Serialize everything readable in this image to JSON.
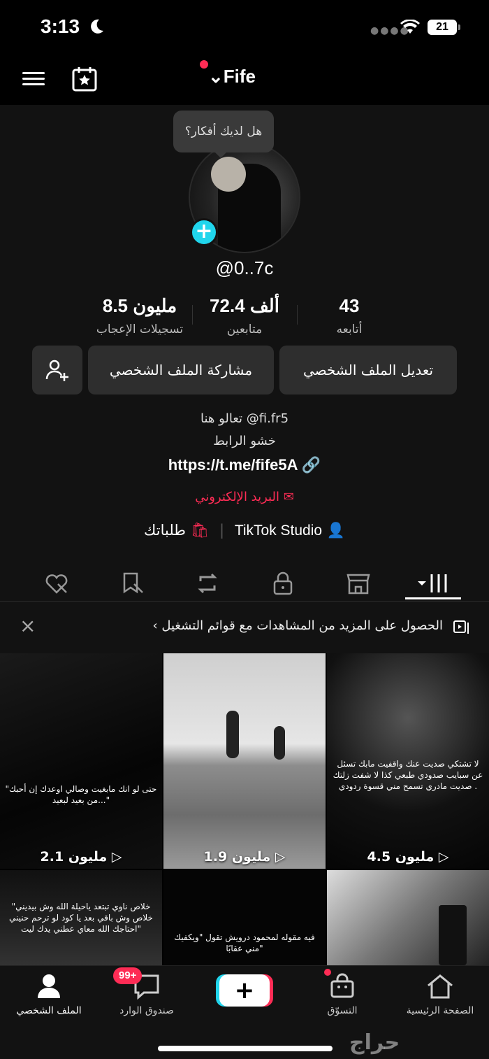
{
  "status_bar": {
    "time": "3:13",
    "battery": "21"
  },
  "top_nav": {
    "account_name": "Fife"
  },
  "profile": {
    "tooltip": "هل لديك أفكار؟",
    "username": "@0..7c",
    "stats": [
      {
        "value": "43",
        "label": "أتابعه"
      },
      {
        "value": "72.4 ألف",
        "label": "متابعين"
      },
      {
        "value": "8.5 مليون",
        "label": "تسجيلات الإعجاب"
      }
    ],
    "buttons": {
      "edit": "تعديل الملف الشخصي",
      "share": "مشاركة الملف الشخصي"
    },
    "bio_line1": "تعالو هنا @fi.fr5",
    "bio_line2": "خشو الرابط",
    "link": "https://t.me/fife5A",
    "email": "البريد الإلكتروني",
    "studio": "TikTok Studio",
    "orders": "طلباتك"
  },
  "banner": {
    "text": "الحصول على المزيد من المشاهدات مع قوائم التشغيل",
    "close": "×"
  },
  "videos": [
    {
      "views": "2.1 مليون",
      "caption": "\"حتى لو انك مابغيت وصالي اوعدك إن أحبك من بعيد لبعيد...\""
    },
    {
      "views": "1.9 مليون",
      "caption": ""
    },
    {
      "views": "4.5 مليون",
      "caption": "لا تشتكي صديت عنك واقفيت مابك تسئل عن سبايب صدودي طبعي كذا لا شفت زلتك صديت مادري تسمح مني قسوة ردودي ."
    },
    {
      "views": "",
      "caption": "\"خلاص ناوي تبتعد ياحيلة الله وش بيديني خلاص وش باقي بعد يا كود لو ترحم حنيني احتاجك الله معاي عطني يدك ليت\""
    },
    {
      "views": "",
      "caption": "فيه مقوله لمحمود درويش تقول \"ويكفيك مني عقابًا\""
    },
    {
      "views": "",
      "caption": ""
    }
  ],
  "bottom_nav": {
    "home": "الصفحة الرئيسية",
    "shop": "التسوّق",
    "inbox": "صندوق الوارد",
    "inbox_badge": "99+",
    "profile": "الملف الشخصي"
  },
  "watermark": "حراج",
  "colors": {
    "accent": "#fe2c55",
    "cyan": "#20d5ec"
  }
}
